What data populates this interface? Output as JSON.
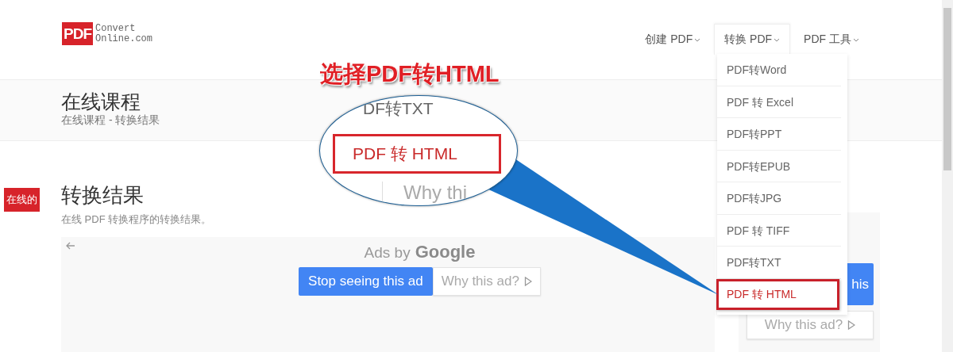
{
  "logo": {
    "mark": "PDF",
    "line1": "Convert",
    "line2": "Online.com"
  },
  "nav": [
    {
      "label": "创建 PDF",
      "selected": false
    },
    {
      "label": "转换 PDF",
      "selected": true
    },
    {
      "label": "PDF 工具",
      "selected": false
    }
  ],
  "dropdown": [
    {
      "label": "PDF转Word",
      "selected": false
    },
    {
      "label": "PDF 转 Excel",
      "selected": false
    },
    {
      "label": "PDF转PPT",
      "selected": false
    },
    {
      "label": "PDF转EPUB",
      "selected": false
    },
    {
      "label": "PDF转JPG",
      "selected": false
    },
    {
      "label": "PDF 转 TIFF",
      "selected": false
    },
    {
      "label": "PDF转TXT",
      "selected": false
    },
    {
      "label": "PDF 转 HTML",
      "selected": true
    }
  ],
  "breadcrumb": {
    "title": "在线课程",
    "path": "在线课程 - 转换结果"
  },
  "side_badge": "在线的",
  "section": {
    "title": "转换结果",
    "subtitle": "在线 PDF 转换程序的转换结果。"
  },
  "ad_left": {
    "ads_by": "Ads by",
    "brand": "Google",
    "stop_button": "Stop seeing this ad",
    "why_button": "Why this ad?"
  },
  "ad_right": {
    "stop_button": "his",
    "why_button": "Why this ad?"
  },
  "annotation": {
    "callout": "选择PDF转HTML",
    "magnifier": {
      "top_text": "DF转TXT",
      "highlight_text": "PDF 转 HTML",
      "bottom_text": "Why thi"
    }
  }
}
